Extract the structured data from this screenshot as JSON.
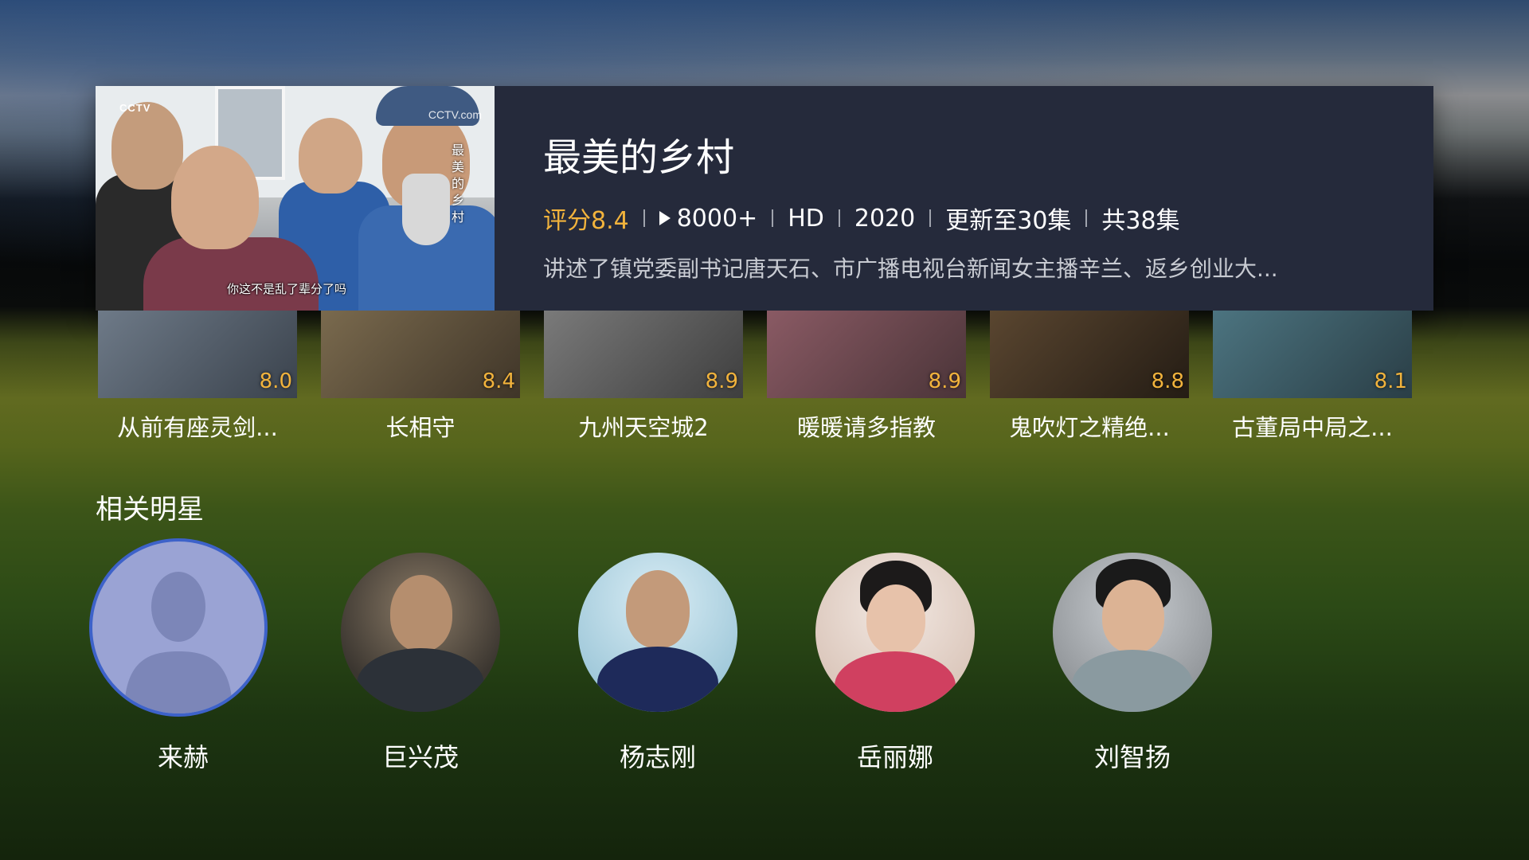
{
  "featured": {
    "title": "最美的乡村",
    "rating": "评分8.4",
    "play_count": "8000+",
    "quality": "HD",
    "year": "2020",
    "update_status": "更新至30集",
    "total_episodes": "共38集",
    "description": "讲述了镇党委副书记唐天石、市广播电视台新闻女主播辛兰、返乡创业大...",
    "poster": {
      "logo_left": "CCTV",
      "logo_right": "CCTV.com",
      "vertical_title": "最美的乡村",
      "subtitle": "你这不是乱了辈分了吗"
    }
  },
  "related_shows": [
    {
      "name": "从前有座灵剑...",
      "score": "8.0",
      "thumb_color": "#5a6470"
    },
    {
      "name": "长相守",
      "score": "8.4",
      "thumb_color": "#5e5140"
    },
    {
      "name": "九州天空城2",
      "score": "8.9",
      "thumb_color": "#606060"
    },
    {
      "name": "暖暖请多指教",
      "score": "8.9",
      "thumb_color": "#6b4c52"
    },
    {
      "name": "鬼吹灯之精绝...",
      "score": "8.8",
      "thumb_color": "#3e3226"
    },
    {
      "name": "古董局中局之...",
      "score": "8.1",
      "thumb_color": "#3d5a66"
    }
  ],
  "stars_section": {
    "title": "相关明星",
    "stars": [
      {
        "name": "来赫",
        "focused": true
      },
      {
        "name": "巨兴茂",
        "focused": false
      },
      {
        "name": "杨志刚",
        "focused": false
      },
      {
        "name": "岳丽娜",
        "focused": false
      },
      {
        "name": "刘智扬",
        "focused": false
      }
    ]
  },
  "colors": {
    "accent_rating": "#f2b33c",
    "card_bg": "#252a3b",
    "focus_ring": "#3d62c9"
  }
}
